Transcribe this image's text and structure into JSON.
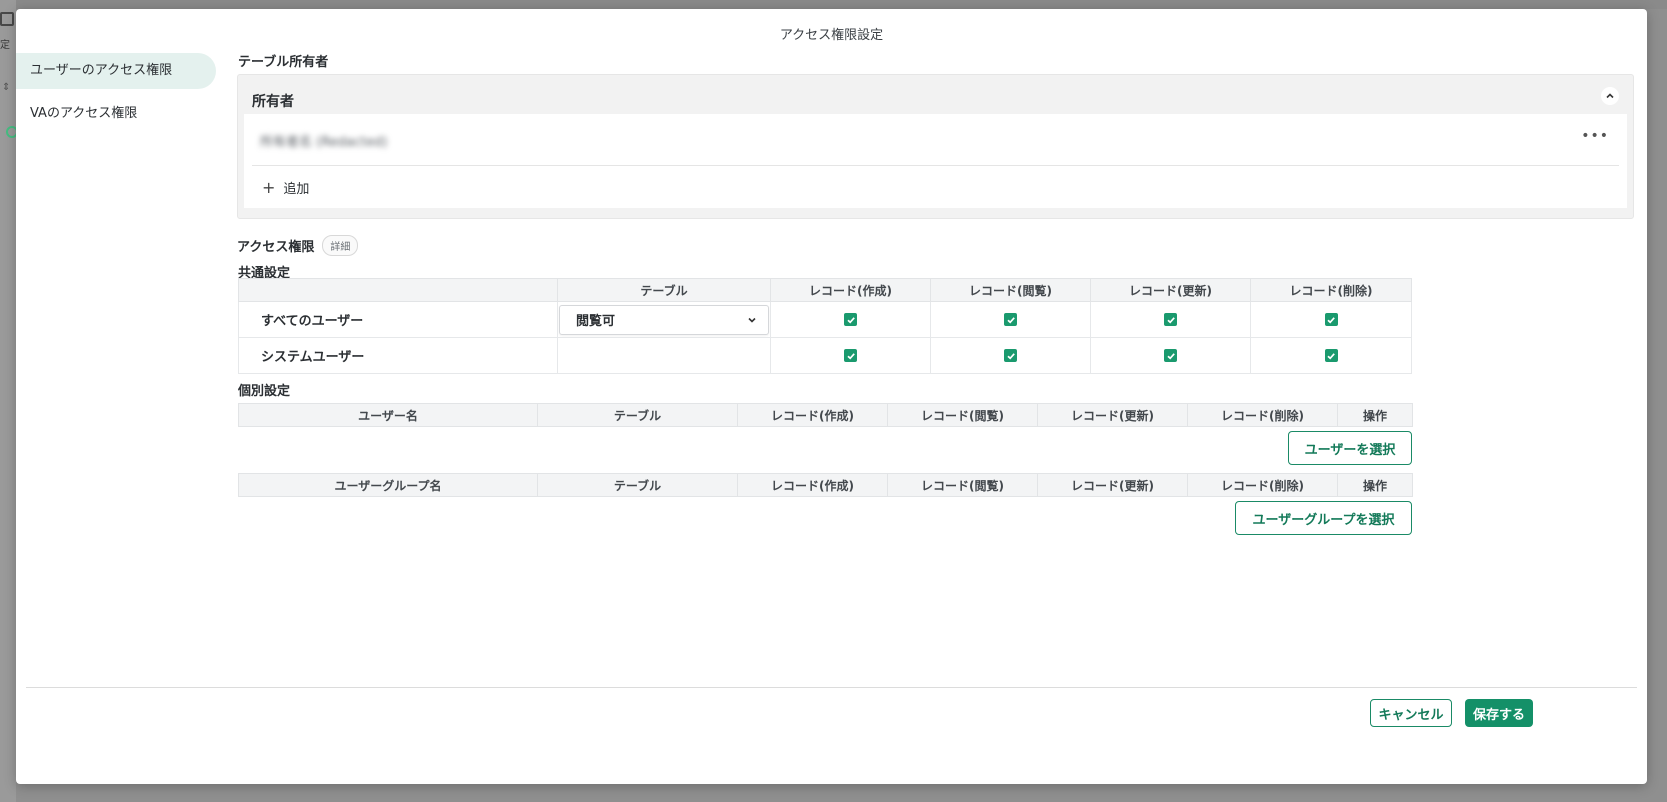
{
  "modal": {
    "title": "アクセス権限設定"
  },
  "background": {
    "partial_label": "定"
  },
  "sidebar": {
    "items": [
      {
        "label": "ユーザーのアクセス権限",
        "active": true
      },
      {
        "label": "VAのアクセス権限",
        "active": false
      }
    ]
  },
  "owner_section": {
    "title": "テーブル所有者",
    "card_title": "所有者",
    "owner_name": "所有者名 (Redacted)",
    "more_label": "•••",
    "add_label": "追加"
  },
  "permissions": {
    "title": "アクセス権限",
    "detail_label": "詳細",
    "common": {
      "title": "共通設定",
      "headers": [
        "",
        "テーブル",
        "レコード(作成)",
        "レコード(閲覧)",
        "レコード(更新)",
        "レコード(削除)"
      ],
      "rows": [
        {
          "label": "すべてのユーザー",
          "table_select": "閲覧可",
          "create": true,
          "read": true,
          "update": true,
          "delete": true
        },
        {
          "label": "システムユーザー",
          "table_select": "",
          "create": true,
          "read": true,
          "update": true,
          "delete": true
        }
      ]
    },
    "individual": {
      "title": "個別設定",
      "user_headers": [
        "ユーザー名",
        "テーブル",
        "レコード(作成)",
        "レコード(閲覧)",
        "レコード(更新)",
        "レコード(削除)",
        "操作"
      ],
      "select_user_button": "ユーザーを選択",
      "group_headers": [
        "ユーザーグループ名",
        "テーブル",
        "レコード(作成)",
        "レコード(閲覧)",
        "レコード(更新)",
        "レコード(削除)",
        "操作"
      ],
      "select_group_button": "ユーザーグループを選択"
    }
  },
  "footer": {
    "cancel_label": "キャンセル",
    "save_label": "保存する"
  },
  "colors": {
    "accent": "#149068",
    "active_nav_bg": "#e4f1ee"
  }
}
